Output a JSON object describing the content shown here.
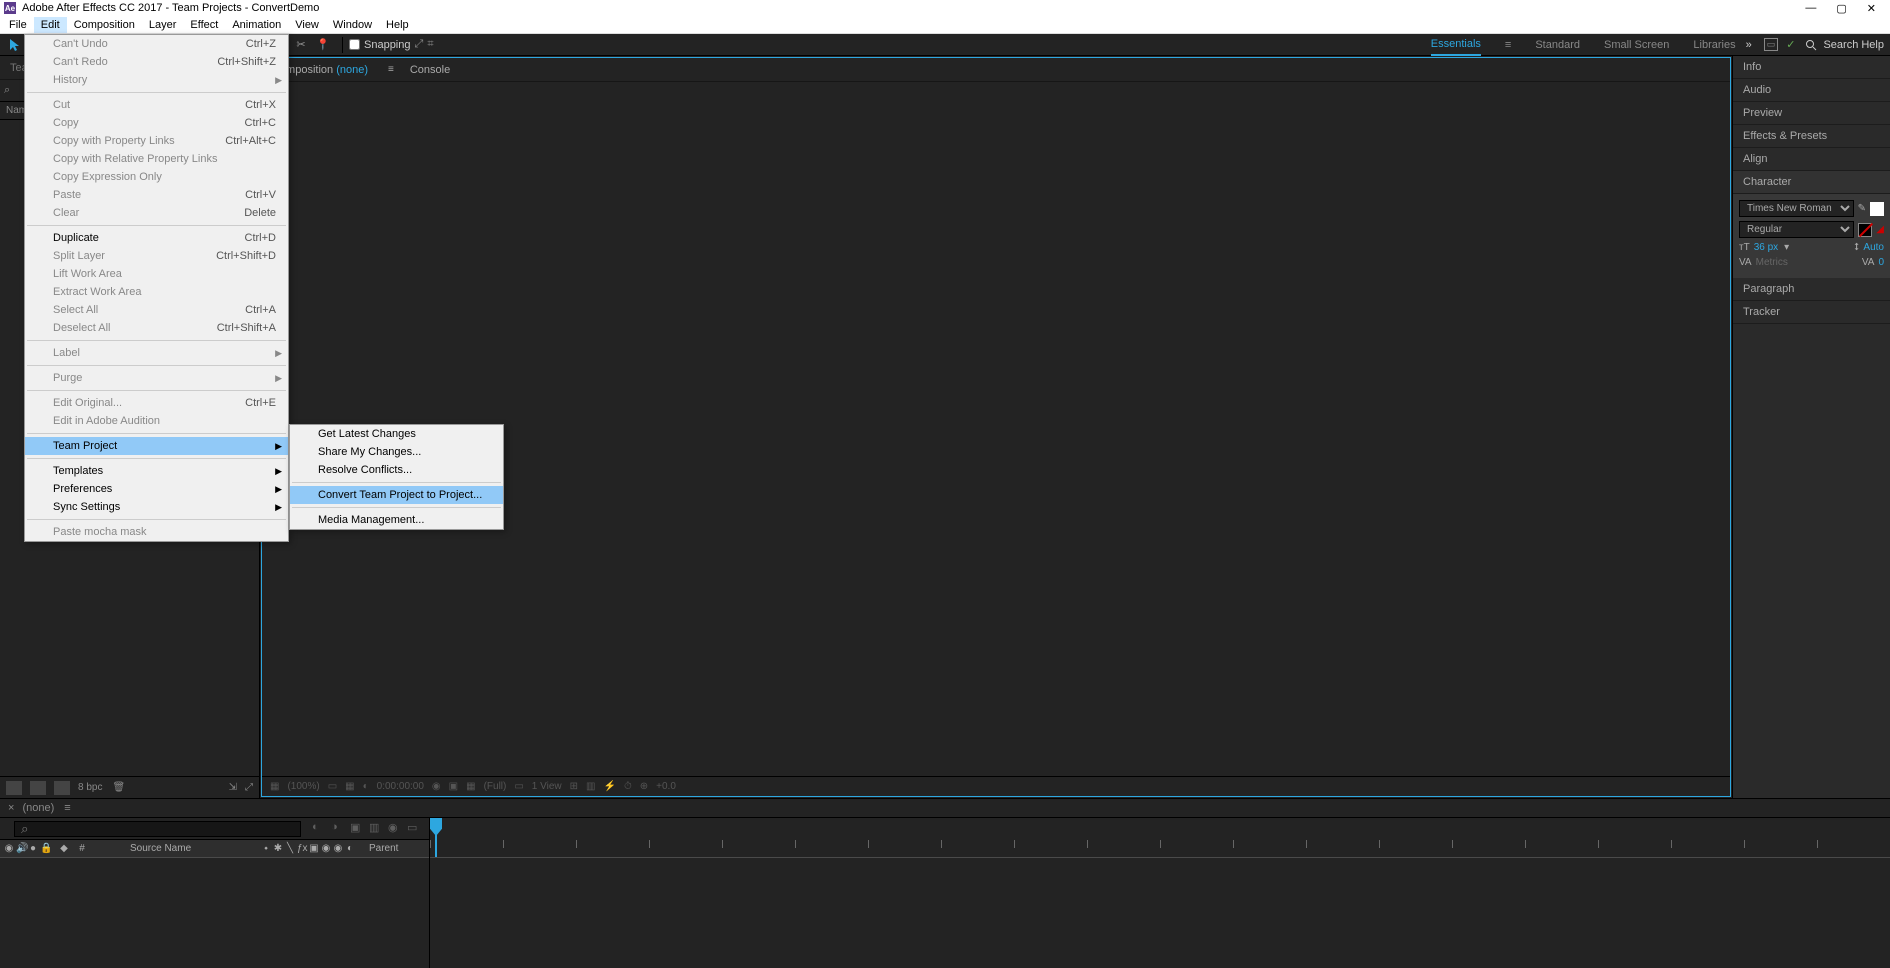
{
  "app": {
    "title": "Adobe After Effects CC 2017 - Team Projects - ConvertDemo",
    "icon_label": "Ae"
  },
  "menubar": {
    "items": [
      "File",
      "Edit",
      "Composition",
      "Layer",
      "Effect",
      "Animation",
      "View",
      "Window",
      "Help"
    ],
    "active_index": 1
  },
  "toolbar": {
    "snapping_label": "Snapping"
  },
  "workspaces": {
    "tabs": [
      "Essentials",
      "Standard",
      "Small Screen",
      "Libraries"
    ],
    "active_index": 0,
    "search_placeholder": "Search Help"
  },
  "edit_menu": {
    "items": [
      {
        "label": "Can't Undo",
        "shortcut": "Ctrl+Z",
        "disabled": true
      },
      {
        "label": "Can't Redo",
        "shortcut": "Ctrl+Shift+Z",
        "disabled": true
      },
      {
        "label": "History",
        "submenu": true,
        "disabled": true
      },
      {
        "sep": true
      },
      {
        "label": "Cut",
        "shortcut": "Ctrl+X",
        "disabled": true
      },
      {
        "label": "Copy",
        "shortcut": "Ctrl+C",
        "disabled": true
      },
      {
        "label": "Copy with Property Links",
        "shortcut": "Ctrl+Alt+C",
        "disabled": true
      },
      {
        "label": "Copy with Relative Property Links",
        "disabled": true
      },
      {
        "label": "Copy Expression Only",
        "disabled": true
      },
      {
        "label": "Paste",
        "shortcut": "Ctrl+V",
        "disabled": true
      },
      {
        "label": "Clear",
        "shortcut": "Delete",
        "disabled": true
      },
      {
        "sep": true
      },
      {
        "label": "Duplicate",
        "shortcut": "Ctrl+D"
      },
      {
        "label": "Split Layer",
        "shortcut": "Ctrl+Shift+D",
        "disabled": true
      },
      {
        "label": "Lift Work Area",
        "disabled": true
      },
      {
        "label": "Extract Work Area",
        "disabled": true
      },
      {
        "label": "Select All",
        "shortcut": "Ctrl+A",
        "disabled": true
      },
      {
        "label": "Deselect All",
        "shortcut": "Ctrl+Shift+A",
        "disabled": true
      },
      {
        "sep": true
      },
      {
        "label": "Label",
        "submenu": true,
        "disabled": true
      },
      {
        "sep": true
      },
      {
        "label": "Purge",
        "submenu": true,
        "disabled": true
      },
      {
        "sep": true
      },
      {
        "label": "Edit Original...",
        "shortcut": "Ctrl+E",
        "disabled": true
      },
      {
        "label": "Edit in Adobe Audition",
        "disabled": true
      },
      {
        "sep": true
      },
      {
        "label": "Team Project",
        "submenu": true,
        "highlight": true
      },
      {
        "sep": true
      },
      {
        "label": "Templates",
        "submenu": true
      },
      {
        "label": "Preferences",
        "submenu": true
      },
      {
        "label": "Sync Settings",
        "submenu": true
      },
      {
        "sep": true
      },
      {
        "label": "Paste mocha mask",
        "disabled": true
      }
    ]
  },
  "team_submenu": {
    "items": [
      {
        "label": "Get Latest Changes"
      },
      {
        "label": "Share My Changes..."
      },
      {
        "label": "Resolve Conflicts..."
      },
      {
        "sep": true
      },
      {
        "label": "Convert Team Project to Project...",
        "highlight": true
      },
      {
        "sep": true
      },
      {
        "label": "Media Management..."
      }
    ]
  },
  "left_panel": {
    "tab_label": "Team Project: ConvertDemo",
    "name_col": "Name",
    "bpc": "8 bpc"
  },
  "center_panel": {
    "tab_prefix": "Composition",
    "tab_none": "(none)",
    "console_tab": "Console",
    "footer": {
      "zoom": "(100%)",
      "time": "0:00:00:00",
      "res": "(Full)",
      "view": "1 View",
      "exposure": "+0.0"
    }
  },
  "right_panel": {
    "headers": [
      "Info",
      "Audio",
      "Preview",
      "Effects & Presets",
      "Align",
      "Character",
      "Paragraph",
      "Tracker"
    ],
    "character": {
      "font": "Times New Roman",
      "style": "Regular",
      "size": "36 px",
      "leading": "Auto",
      "kerning": "Metrics",
      "tracking": "0"
    }
  },
  "timeline": {
    "tab_none": "(none)",
    "source_name": "Source Name",
    "parent": "Parent"
  }
}
